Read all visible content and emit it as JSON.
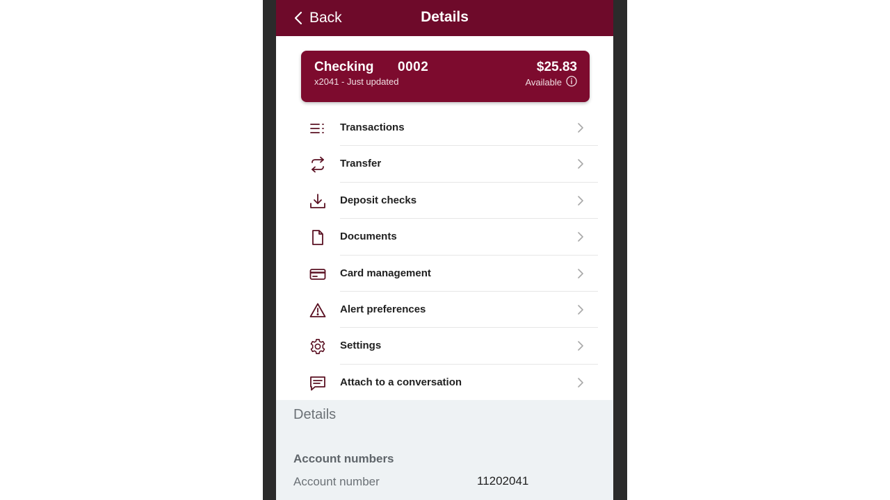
{
  "header": {
    "back_label": "Back",
    "title": "Details"
  },
  "account": {
    "name": "Checking",
    "suffix": "0002",
    "sub": "x2041 - Just updated",
    "balance": "$25.83",
    "available_label": "Available"
  },
  "menu": [
    {
      "label": "Transactions",
      "icon": "list-icon"
    },
    {
      "label": "Transfer",
      "icon": "transfer-icon"
    },
    {
      "label": "Deposit checks",
      "icon": "download-icon"
    },
    {
      "label": "Documents",
      "icon": "document-icon"
    },
    {
      "label": "Card management",
      "icon": "credit-card-icon"
    },
    {
      "label": "Alert preferences",
      "icon": "warning-icon"
    },
    {
      "label": "Settings",
      "icon": "gear-icon"
    },
    {
      "label": "Attach to a conversation",
      "icon": "chat-icon"
    }
  ],
  "details": {
    "heading": "Details",
    "account_numbers_heading": "Account numbers",
    "account_number_label": "Account number",
    "account_number_value": "11202041"
  },
  "colors": {
    "header": "#6e0a2a",
    "card": "#7d0b2e",
    "icon": "#5a1022",
    "details_bg": "#eef2f4"
  }
}
